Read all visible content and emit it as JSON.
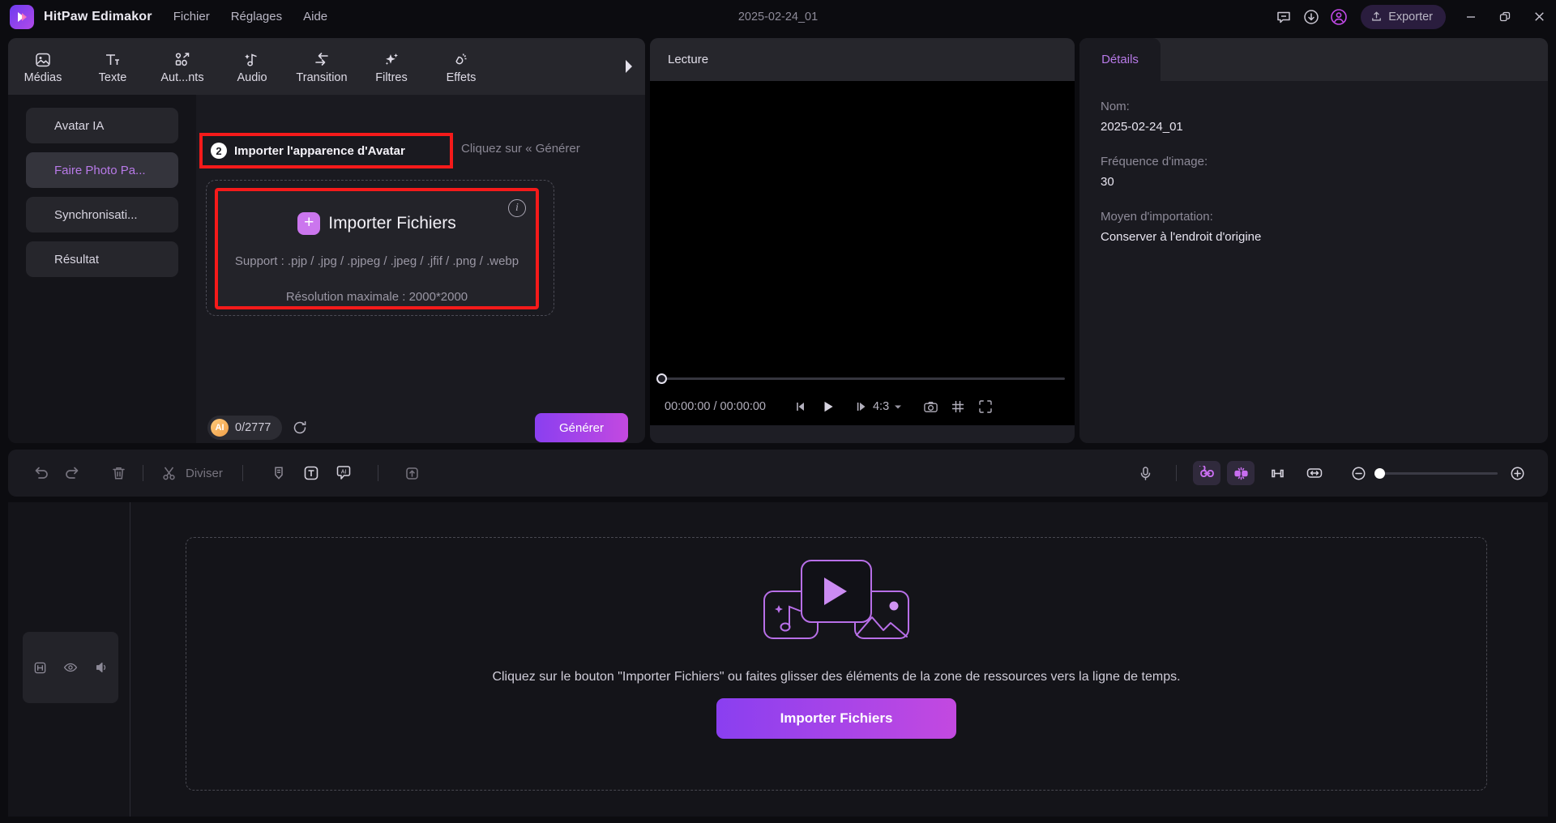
{
  "app": {
    "name": "HitPaw Edimakor",
    "logo_icon": "hitpaw-logo-icon",
    "document_title": "2025-02-24_01"
  },
  "menubar": {
    "items": [
      {
        "label": "Fichier"
      },
      {
        "label": "Réglages"
      },
      {
        "label": "Aide"
      }
    ]
  },
  "titlebar_actions": {
    "feedback_icon": "feedback-bubble-icon",
    "download_icon": "download-circle-icon",
    "account_icon": "account-circle-icon",
    "export_label": "Exporter",
    "export_icon": "upload-icon",
    "minimize_icon": "minimize-icon",
    "maximize_icon": "restore-window-icon",
    "close_icon": "close-icon"
  },
  "tool_tabs": [
    {
      "label": "Médias",
      "icon": "media-image-icon"
    },
    {
      "label": "Texte",
      "icon": "text-icon"
    },
    {
      "label": "Aut...nts",
      "icon": "elements-icon"
    },
    {
      "label": "Audio",
      "icon": "audio-note-icon"
    },
    {
      "label": "Transition",
      "icon": "transition-arrow-icon"
    },
    {
      "label": "Filtres",
      "icon": "filters-sparkle-icon"
    },
    {
      "label": "Effets",
      "icon": "effects-icon"
    }
  ],
  "tool_tabs_more_icon": "chevron-right-icon",
  "sub_sidebar": {
    "items": [
      {
        "label": "Avatar IA",
        "active": false
      },
      {
        "label": "Faire Photo Pa...",
        "active": true
      },
      {
        "label": "Synchronisati...",
        "active": false
      },
      {
        "label": "Résultat",
        "active": false
      }
    ]
  },
  "import_step": {
    "number": "2",
    "label": "Importer l'apparence d'Avatar",
    "hint": "Cliquez sur « Générer",
    "highlight_color": "#f51a1a"
  },
  "dropzone": {
    "plus_icon": "plus-icon",
    "title": "Importer Fichiers",
    "info_icon": "info-icon",
    "support_text": "Support : .pjp / .jpg / .pjpeg / .jpeg / .jfif / .png / .webp",
    "resolution_text": "Résolution maximale : 2000*2000"
  },
  "left_footer": {
    "credit_badge": "AI",
    "credit_count": "0/2777",
    "refresh_icon": "refresh-icon",
    "generate_label": "Générer"
  },
  "preview": {
    "header_title": "Lecture",
    "time_display": "00:00:00 / 00:00:00",
    "prev_frame_icon": "previous-frame-icon",
    "play_icon": "play-icon",
    "next_frame_icon": "next-frame-icon",
    "aspect_ratio": "4:3",
    "aspect_caret_icon": "caret-down-icon",
    "snapshot_icon": "camera-icon",
    "grid_icon": "grid-icon",
    "fullscreen_icon": "fullscreen-icon"
  },
  "details": {
    "tab_label": "Détails",
    "fields": [
      {
        "label": "Nom:",
        "value": "2025-02-24_01"
      },
      {
        "label": "Fréquence d'image:",
        "value": "30"
      },
      {
        "label": "Moyen d'importation:",
        "value": "Conserver à l'endroit d'origine"
      }
    ]
  },
  "timeline_toolbar": {
    "undo_icon": "undo-icon",
    "redo_icon": "redo-icon",
    "delete_icon": "trash-icon",
    "split_label": "Diviser",
    "split_icon": "scissors-icon",
    "marker_icon": "marker-icon",
    "text_icon": "text-box-icon",
    "ai_icon": "ai-caption-icon",
    "export_clip_icon": "export-clip-icon",
    "mic_icon": "microphone-icon",
    "link_icon": "link-clips-icon",
    "detach_icon": "detach-audio-icon",
    "crop_icon": "crop-icon",
    "fit_icon": "fit-timeline-icon",
    "zoom_out_icon": "zoom-out-icon",
    "zoom_in_icon": "zoom-in-icon"
  },
  "track_header": {
    "lock_icon": "lock-track-icon",
    "eye_icon": "visibility-icon",
    "mute_icon": "mute-icon"
  },
  "timeline_drop": {
    "illustration_icon": "media-collection-icon",
    "hint": "Cliquez sur le bouton \"Importer Fichiers\" ou faites glisser des éléments de la zone de ressources vers la ligne de temps.",
    "button_label": "Importer Fichiers"
  },
  "colors": {
    "accent_purple": "#b87ae8",
    "gradient_start": "#8a3ff0",
    "gradient_end": "#c349e0",
    "highlight_red": "#f51a1a",
    "background": "#0c0c10"
  }
}
